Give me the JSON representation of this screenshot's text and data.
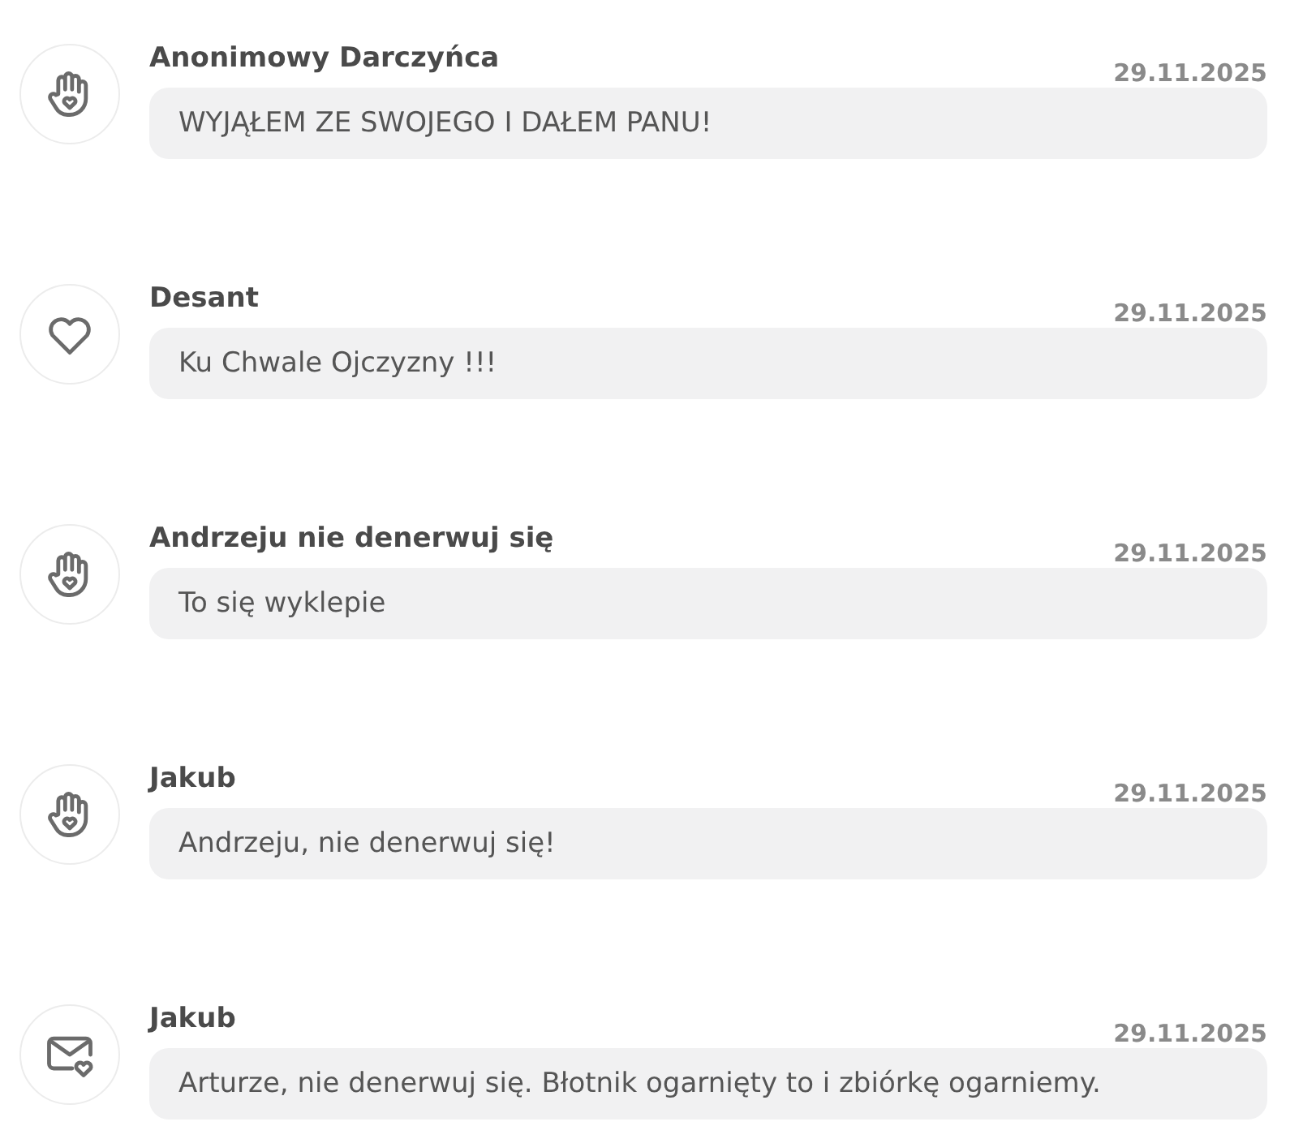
{
  "donations": [
    {
      "kind": "hand",
      "name": "Anonimowy Darczyńca",
      "date": "29.11.2025",
      "message": "WYJĄŁEM ZE SWOJEGO I DAŁEM PANU!"
    },
    {
      "kind": "heart",
      "name": "Desant",
      "date": "29.11.2025",
      "message": "Ku Chwale Ojczyzny !!!"
    },
    {
      "kind": "hand",
      "name": "Andrzeju nie denerwuj się",
      "date": "29.11.2025",
      "message": "To się wyklepie"
    },
    {
      "kind": "hand",
      "name": "Jakub",
      "date": "29.11.2025",
      "message": "Andrzeju, nie denerwuj się!"
    },
    {
      "kind": "envelope",
      "name": "Jakub",
      "date": "29.11.2025",
      "message": "Arturze, nie denerwuj się. Błotnik ogarnięty to i zbiórkę ogarniemy."
    }
  ]
}
